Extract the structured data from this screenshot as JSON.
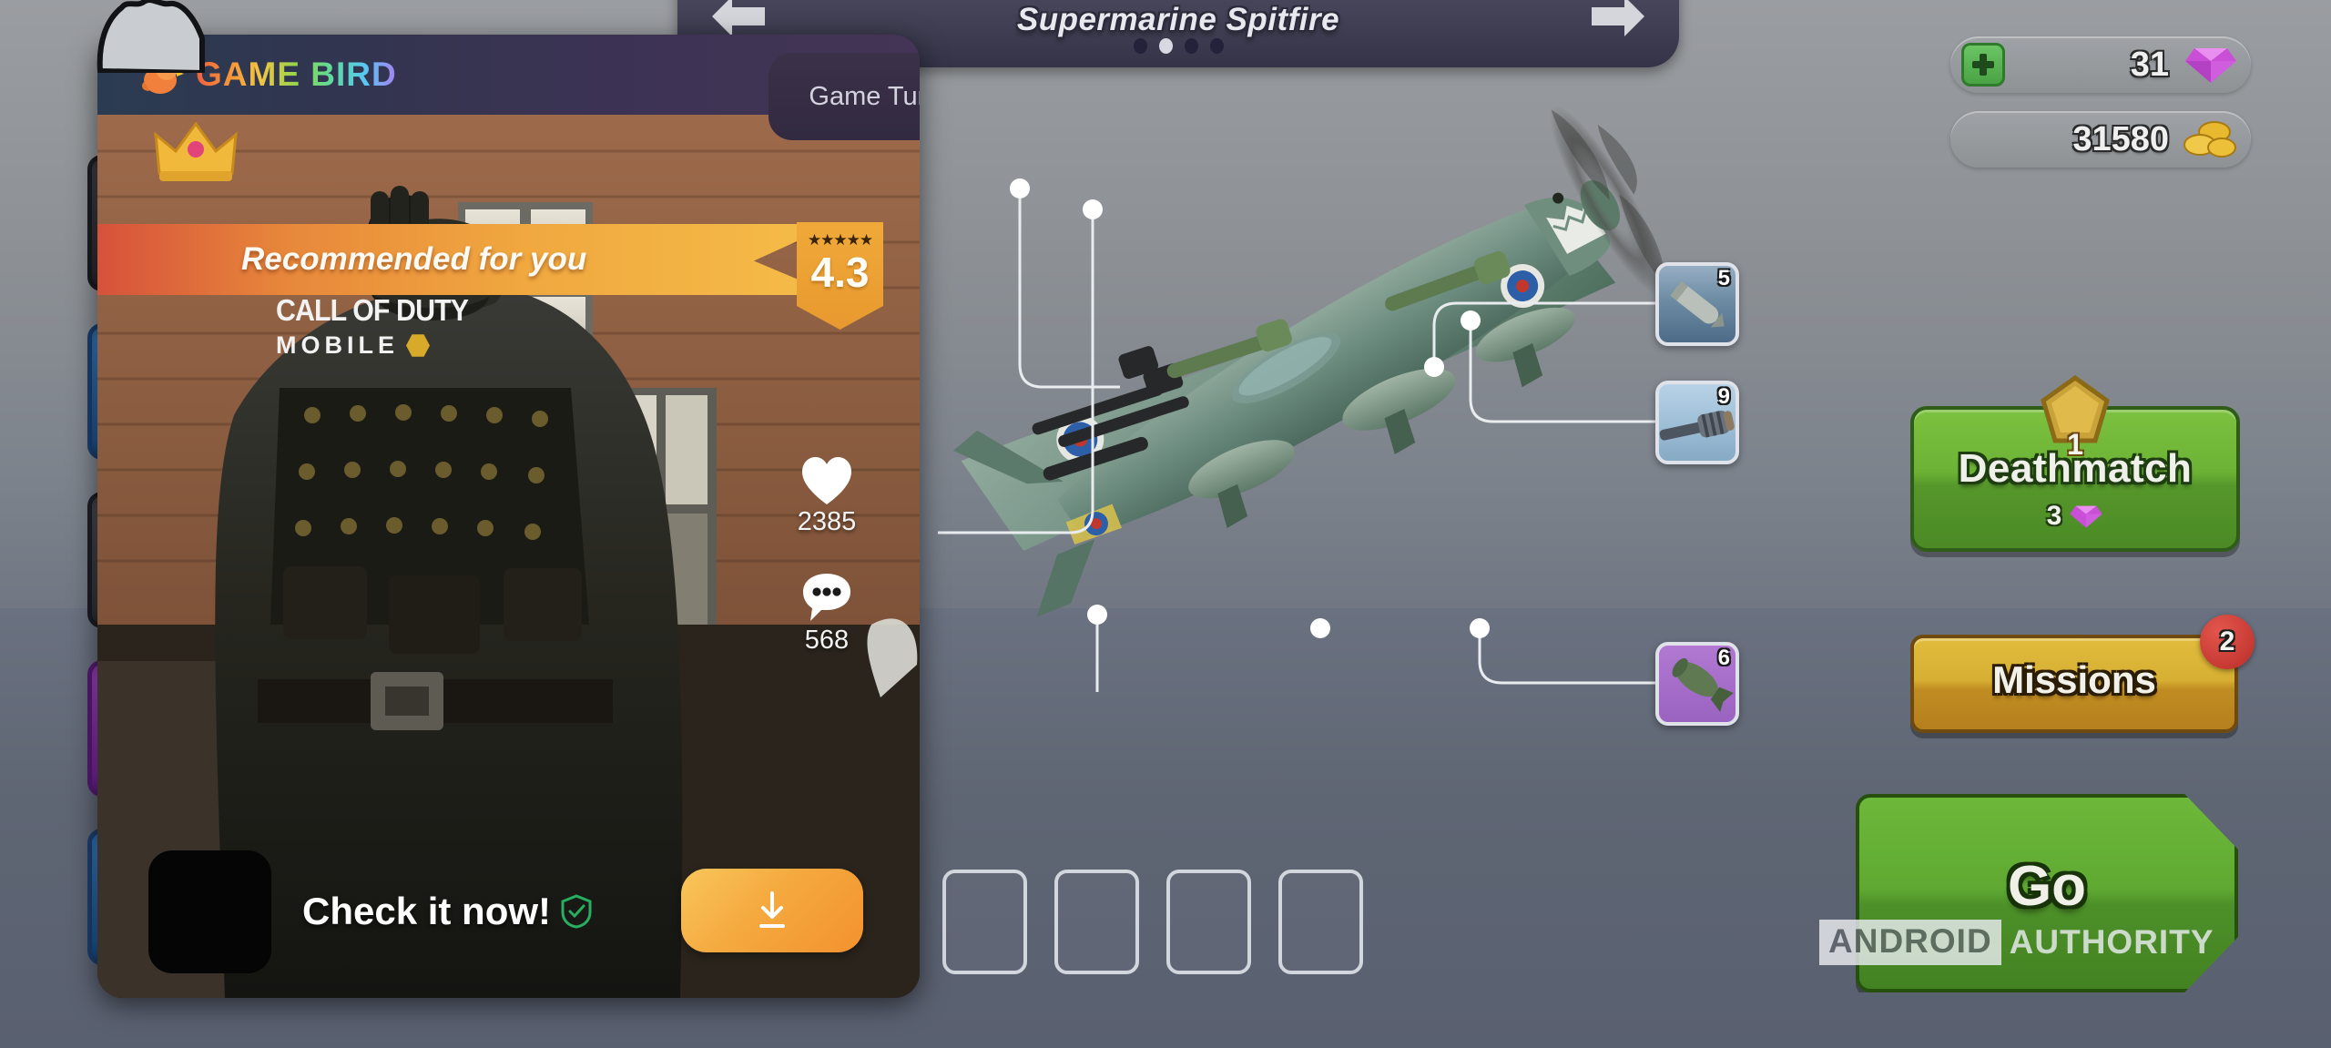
{
  "game": {
    "title": "Supermarine Spitfire",
    "carousel": {
      "total_dots": 4,
      "active_index": 1
    },
    "nav": {
      "prev_label": "Previous plane",
      "next_label": "Next plane"
    },
    "currency": {
      "gems": {
        "value": "31",
        "icon": "gem-icon",
        "color": "#c84fd6"
      },
      "coins": {
        "value": "31580",
        "icon": "coin-icon",
        "color": "#e8b82e"
      },
      "add_label": "+"
    },
    "buttons": {
      "deathmatch": {
        "label": "Deathmatch",
        "rank": "1",
        "cost": "3",
        "cost_icon": "gem-icon",
        "color": "#6cb235"
      },
      "missions": {
        "label": "Missions",
        "badge": "2",
        "color": "#d7b033",
        "badge_color": "#c63a33"
      },
      "go": {
        "label": "Go",
        "color": "#5fa932"
      }
    },
    "weapon_slots": [
      {
        "number": "5",
        "name": "rocket-slot",
        "bg": "#6f8ea6"
      },
      {
        "number": "9",
        "name": "cannon-slot",
        "bg": "#9fc0d8"
      },
      {
        "number": "6",
        "name": "bomb-slot",
        "bg": "#9a63c0"
      }
    ],
    "empty_slots": 4,
    "rail_items": [
      {
        "color": "#3a3b43"
      },
      {
        "color": "#2f7fd4"
      },
      {
        "color": "#4a4b52"
      },
      {
        "color": "#a840d8"
      },
      {
        "color": "#2f7fd4"
      }
    ],
    "watermark": {
      "part1": "ANDROID",
      "part2": "AUTHORITY"
    }
  },
  "ad": {
    "brand": {
      "name": "GAME BIRD",
      "icon": "bird-icon"
    },
    "turbo": {
      "label": "Game Turbo",
      "icon": "play-triangle-icon"
    },
    "recommend_banner": {
      "text": "Recommended for you",
      "icon": "crown-icon"
    },
    "rating": {
      "stars": "★★★★★",
      "value": "4.3"
    },
    "promoted_app": {
      "line1": "CALL OF DUTY",
      "line2": "MOBILE",
      "badge_icon": "hex-icon"
    },
    "social": {
      "likes": {
        "count": "2385",
        "icon": "heart-icon"
      },
      "comments": {
        "count": "568",
        "icon": "comment-icon"
      }
    },
    "cta": {
      "text": "Check it now!",
      "verified_icon": "shield-check-icon",
      "download_icon": "download-icon"
    }
  }
}
